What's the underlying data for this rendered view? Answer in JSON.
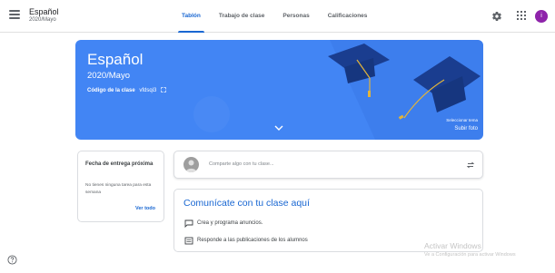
{
  "app": {
    "course_name": "Español",
    "course_section": "2020/Mayo"
  },
  "tabs": [
    {
      "label": "Tablón",
      "active": true
    },
    {
      "label": "Trabajo de clase",
      "active": false
    },
    {
      "label": "Personas",
      "active": false
    },
    {
      "label": "Calificaciones",
      "active": false
    }
  ],
  "user": {
    "avatar_letter": "i",
    "avatar_color": "#8e24aa"
  },
  "banner": {
    "title": "Español",
    "subtitle": "2020/Mayo",
    "class_code_label": "Código de la clase",
    "class_code_value": "vfdsqi3",
    "select_theme": "Seleccionar tema",
    "upload_photo": "Subir foto",
    "color": "#4285f4"
  },
  "due": {
    "title": "Fecha de entrega próxima",
    "empty_text": "No tienes ninguna tarea para esta semana",
    "see_all": "Ver todo"
  },
  "share": {
    "placeholder": "Comparte algo con tu clase..."
  },
  "communicate": {
    "title": "Comunícate con tu clase aquí",
    "items": [
      {
        "label": "Crea y programa anuncios.",
        "icon": "announcement-icon"
      },
      {
        "label": "Responde a las publicaciones de los alumnos",
        "icon": "reply-icon"
      }
    ]
  },
  "watermark": {
    "line1": "Activar Windows",
    "line2": "Ve a Configuración para activar Windows"
  },
  "colors": {
    "accent": "#1967d2",
    "banner": "#4285f4"
  }
}
